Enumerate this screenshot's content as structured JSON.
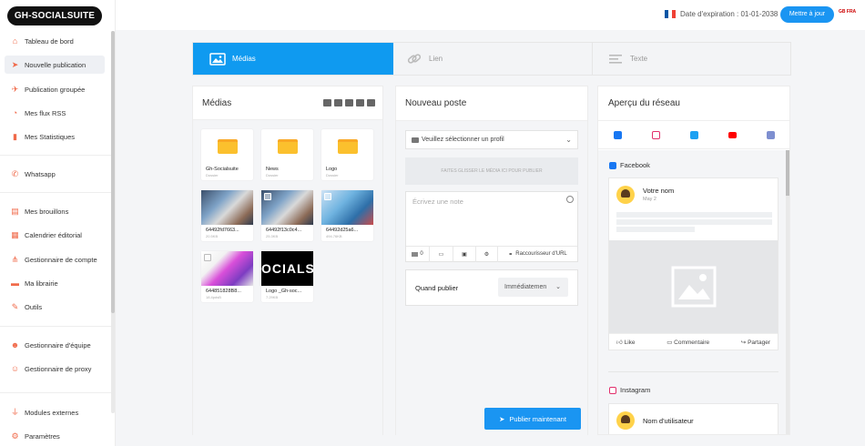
{
  "brand": {
    "logo_prefix": "GH-",
    "logo_main": "SOCIALSUITE"
  },
  "header": {
    "expiration": "Date d'expiration : 01-01-2038",
    "update_button": "Mettre à jour",
    "lang_label": "GB FRA"
  },
  "sidebar": {
    "items": [
      {
        "label": "Tableau de bord",
        "icon": "home-icon"
      },
      {
        "label": "Nouvelle publication",
        "icon": "paper-plane-icon"
      },
      {
        "label": "Publication groupée",
        "icon": "rocket-icon"
      },
      {
        "label": "Mes flux RSS",
        "icon": "rss-icon"
      },
      {
        "label": "Mes Statistiques",
        "icon": "chart-icon"
      },
      {
        "label": "Whatsapp",
        "icon": "whatsapp-icon"
      },
      {
        "label": "Mes brouillons",
        "icon": "draft-icon"
      },
      {
        "label": "Calendrier éditorial",
        "icon": "calendar-icon"
      },
      {
        "label": "Gestionnaire de compte",
        "icon": "share-icon"
      },
      {
        "label": "Ma librairie",
        "icon": "folder-icon"
      },
      {
        "label": "Outils",
        "icon": "tools-icon"
      },
      {
        "label": "Gestionnaire d'équipe",
        "icon": "team-icon"
      },
      {
        "label": "Gestionnaire de proxy",
        "icon": "user-shield-icon"
      },
      {
        "label": "Modules externes",
        "icon": "plug-icon"
      },
      {
        "label": "Paramètres",
        "icon": "gear-icon"
      }
    ]
  },
  "tabs": [
    {
      "label": "Médias"
    },
    {
      "label": "Lien"
    },
    {
      "label": "Texte"
    }
  ],
  "media": {
    "title": "Médias",
    "items": [
      {
        "name": "Gh-Socialsuite",
        "sub": "Dossier"
      },
      {
        "name": "News",
        "sub": "Dossier"
      },
      {
        "name": "Logo",
        "sub": "Dossier"
      },
      {
        "name": "64492fd7663...",
        "sub": "20.5KB"
      },
      {
        "name": "64492f13c0c4...",
        "sub": "25.3KB"
      },
      {
        "name": "64492d25a6...",
        "sub": "494.76KB"
      },
      {
        "name": "644851828B8...",
        "sub": "18.4pdsB"
      },
      {
        "name": "Logo _Gh-soc...",
        "sub": "7.29KB"
      }
    ],
    "logo_thumb_text": "OCIALS"
  },
  "post": {
    "title": "Nouveau poste",
    "profile_placeholder": "Veuillez sélectionner un profil",
    "drop_zone": "FAITES GLISSER LE MÉDIA ICI POUR PUBLIER",
    "note_placeholder": "Écrivez une note",
    "counter": "0",
    "shortener": "Raccourisseur d'URL",
    "when_label": "Quand publier",
    "when_value": "Immédiatemen",
    "publish_button": "Publier maintenant"
  },
  "preview": {
    "title": "Aperçu du réseau",
    "facebook_label": "Facebook",
    "user_name": "Votre nom",
    "date": "May 2",
    "like": "Like",
    "comment": "Commentaire",
    "share": "Partager",
    "instagram_label": "Instagram",
    "ig_user": "Nom d'utilisateur"
  },
  "colors": {
    "accent": "#1a95f2",
    "sidebar_icon": "#f06a4a",
    "facebook": "#1877f2",
    "instagram": "#e1306c",
    "twitter": "#1da1f2",
    "youtube": "#ff0000"
  }
}
